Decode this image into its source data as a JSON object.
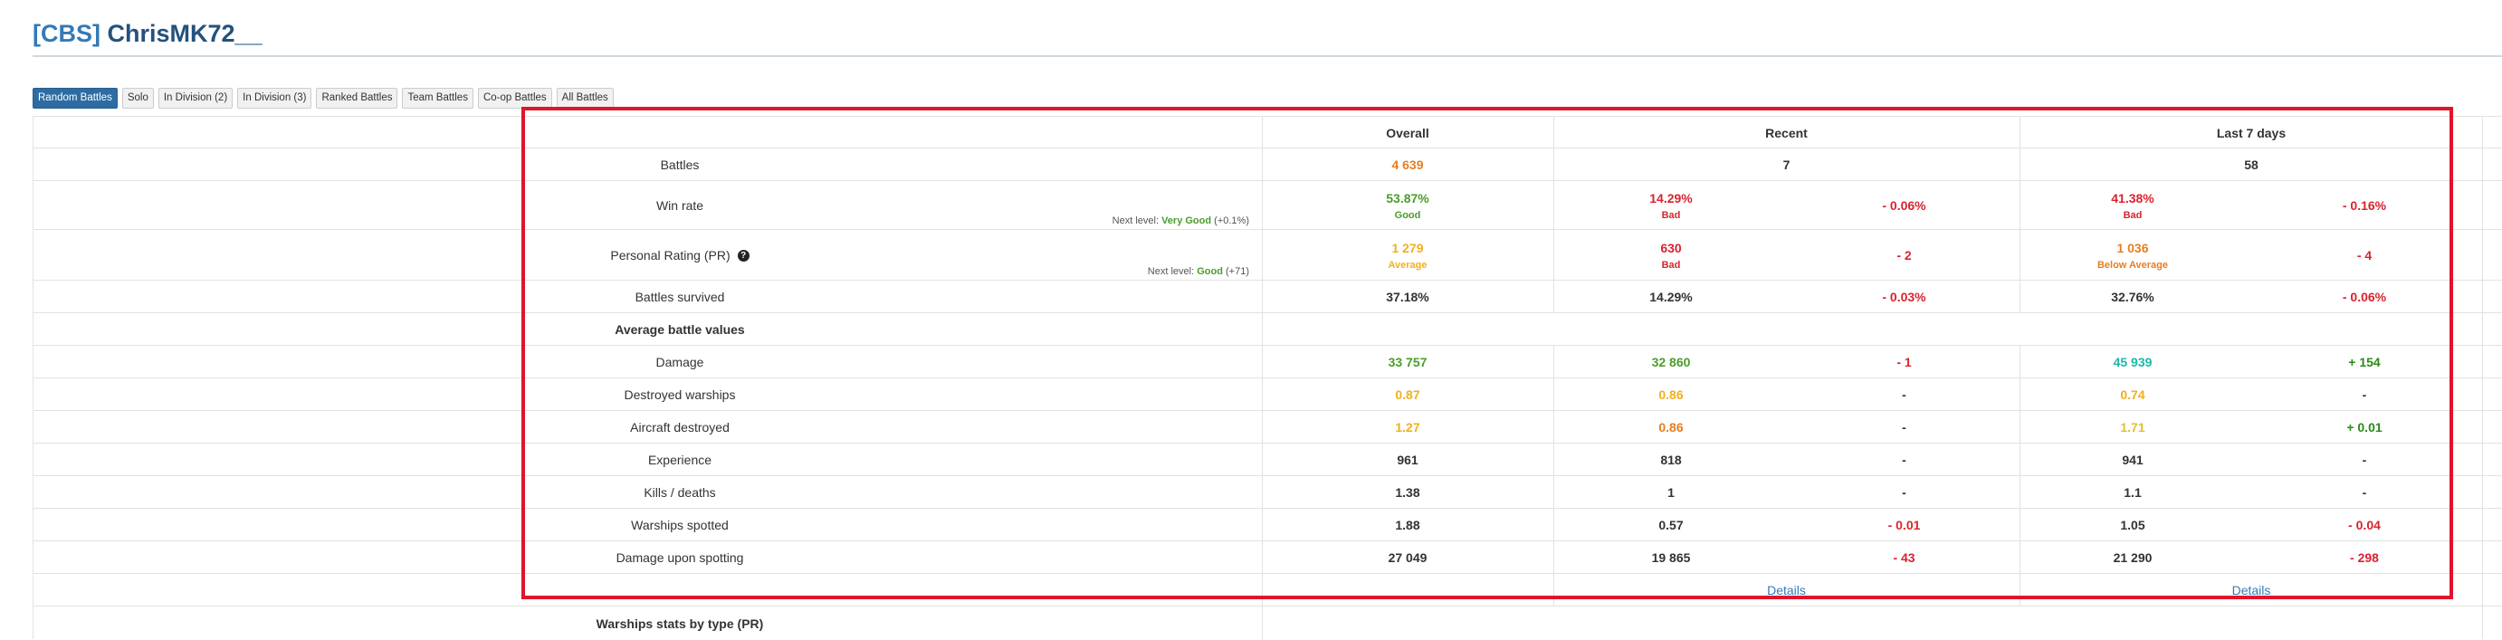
{
  "page": {
    "clan_tag": "[CBS]",
    "player_name": "ChrisMK72__"
  },
  "tabs": [
    {
      "label": "Random Battles",
      "active": true
    },
    {
      "label": "Solo",
      "active": false
    },
    {
      "label": "In Division (2)",
      "active": false
    },
    {
      "label": "In Division (3)",
      "active": false
    },
    {
      "label": "Ranked Battles",
      "active": false
    },
    {
      "label": "Team Battles",
      "active": false
    },
    {
      "label": "Co-op Battles",
      "active": false
    },
    {
      "label": "All Battles",
      "active": false
    }
  ],
  "columns": {
    "overall": "Overall",
    "recent": "Recent",
    "last7": "Last 7 days"
  },
  "colors": {
    "orange": "#e67e22",
    "yellow": "#f0b020",
    "green": "#4a9d2a",
    "dark_green": "#2a8a1a",
    "teal": "#1ab8a8",
    "red": "#d9232e",
    "dark": "#333333"
  },
  "rows": {
    "battles": {
      "label": "Battles",
      "overall": "4 639",
      "recent": "7",
      "last7": "58"
    },
    "winrate": {
      "label": "Win rate",
      "next_prefix": "Next level:",
      "next_level": "Very Good",
      "next_amount": "(+0.1%)",
      "overall": "53.87%",
      "overall_sub": "Good",
      "recent": "14.29%",
      "recent_sub": "Bad",
      "recent_diff": "- 0.06%",
      "last7": "41.38%",
      "last7_sub": "Bad",
      "last7_diff": "- 0.16%"
    },
    "pr": {
      "label": "Personal Rating (PR)",
      "icon": "?",
      "next_prefix": "Next level:",
      "next_level": "Good",
      "next_amount": "(+71)",
      "overall": "1 279",
      "overall_sub": "Average",
      "recent": "630",
      "recent_sub": "Bad",
      "recent_diff": "- 2",
      "last7": "1 036",
      "last7_sub": "Below Average",
      "last7_diff": "- 4"
    },
    "survived": {
      "label": "Battles survived",
      "overall": "37.18%",
      "recent": "14.29%",
      "recent_diff": "- 0.03%",
      "last7": "32.76%",
      "last7_diff": "- 0.06%"
    },
    "avg_header": {
      "label": "Average battle values"
    },
    "damage": {
      "label": "Damage",
      "overall": "33 757",
      "recent": "32 860",
      "recent_diff": "- 1",
      "last7": "45 939",
      "last7_diff": "+ 154"
    },
    "destroyed": {
      "label": "Destroyed warships",
      "overall": "0.87",
      "recent": "0.86",
      "recent_diff": "-",
      "last7": "0.74",
      "last7_diff": "-"
    },
    "aircraft": {
      "label": "Aircraft destroyed",
      "overall": "1.27",
      "recent": "0.86",
      "recent_diff": "-",
      "last7": "1.71",
      "last7_diff": "+ 0.01"
    },
    "experience": {
      "label": "Experience",
      "overall": "961",
      "recent": "818",
      "recent_diff": "-",
      "last7": "941",
      "last7_diff": "-"
    },
    "kd": {
      "label": "Kills / deaths",
      "overall": "1.38",
      "recent": "1",
      "recent_diff": "-",
      "last7": "1.1",
      "last7_diff": "-"
    },
    "spotted": {
      "label": "Warships spotted",
      "overall": "1.88",
      "recent": "0.57",
      "recent_diff": "- 0.01",
      "last7": "1.05",
      "last7_diff": "- 0.04"
    },
    "spotting_dmg": {
      "label": "Damage upon spotting",
      "overall": "27 049",
      "recent": "19 865",
      "recent_diff": "- 43",
      "last7": "21 290",
      "last7_diff": "- 298"
    },
    "details": {
      "recent": "Details",
      "last7": "Details"
    },
    "by_type": {
      "label": "Warships stats by type (PR)"
    }
  }
}
